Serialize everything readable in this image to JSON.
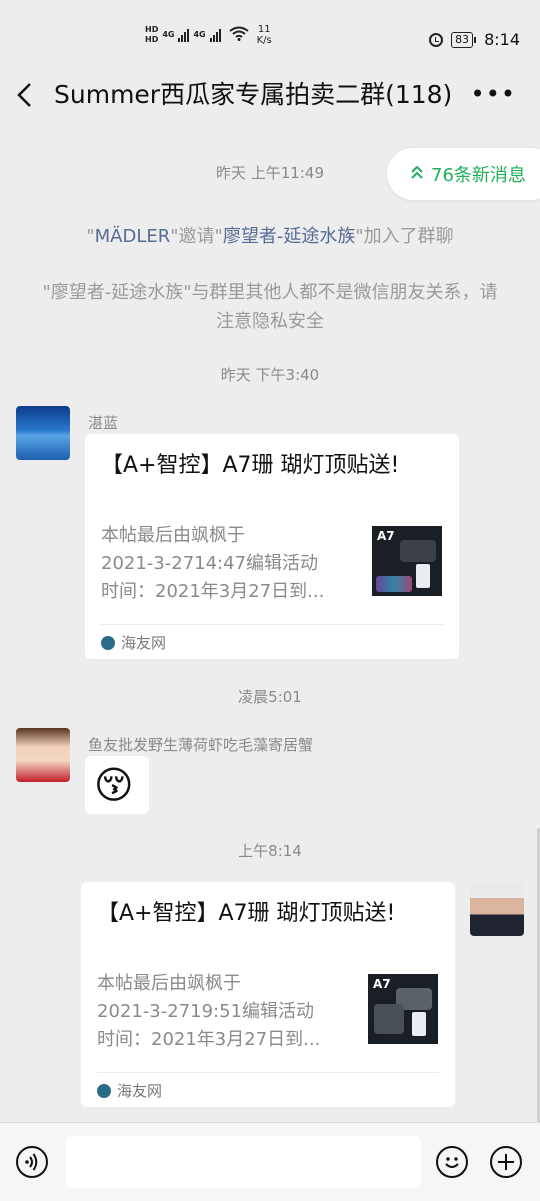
{
  "status_bar": {
    "net_top": "HD",
    "net_bottom": "HD",
    "gen1": "4G",
    "gen2": "4G",
    "speed_value": "11",
    "speed_unit": "K/s",
    "battery": "83",
    "time": "8:14"
  },
  "header": {
    "back_icon": "chevron-left-icon",
    "title": "Summer西瓜家专属拍卖二群(118)",
    "more": "•••"
  },
  "new_messages": {
    "label": "76条新消息",
    "icon": "double-chevron-up-icon"
  },
  "timestamps": {
    "t1": "昨天 上午11:49",
    "t2": "昨天 下午3:40",
    "t3": "凌晨5:01",
    "t4": "上午8:14"
  },
  "system_messages": {
    "invite": {
      "q1": "\"",
      "inviter": "MÄDLER",
      "q2": "\"邀请\"",
      "invitee": "廖望者-延途水族",
      "q3": "\"加入了群聊"
    },
    "privacy": "\"廖望者-延途水族\"与群里其他人都不是微信朋友关系，请注意隐私安全"
  },
  "messages": {
    "m1": {
      "sender": "湛蓝",
      "title": "【A+智控】A7珊 瑚灯顶贴送!",
      "desc1": "本帖最后由飒枫于",
      "desc2": "2021-3-2714:47编辑活动",
      "desc3": "时间：2021年3月27日到...",
      "thumb_label": "A7",
      "source": "海友网"
    },
    "m2": {
      "sender": "鱼友批发野生薄荷虾吃毛藻寄居蟹",
      "sticker": "😚"
    },
    "m3": {
      "title": "【A+智控】A7珊 瑚灯顶贴送!",
      "desc1": "本帖最后由飒枫于",
      "desc2": "2021-3-2719:51编辑活动",
      "desc3": "时间：2021年3月27日到...",
      "thumb_label": "A7",
      "source": "海友网"
    }
  },
  "input_bar": {
    "voice_icon": "voice-icon",
    "emoji_icon": "emoji-icon",
    "plus_icon": "plus-icon"
  }
}
